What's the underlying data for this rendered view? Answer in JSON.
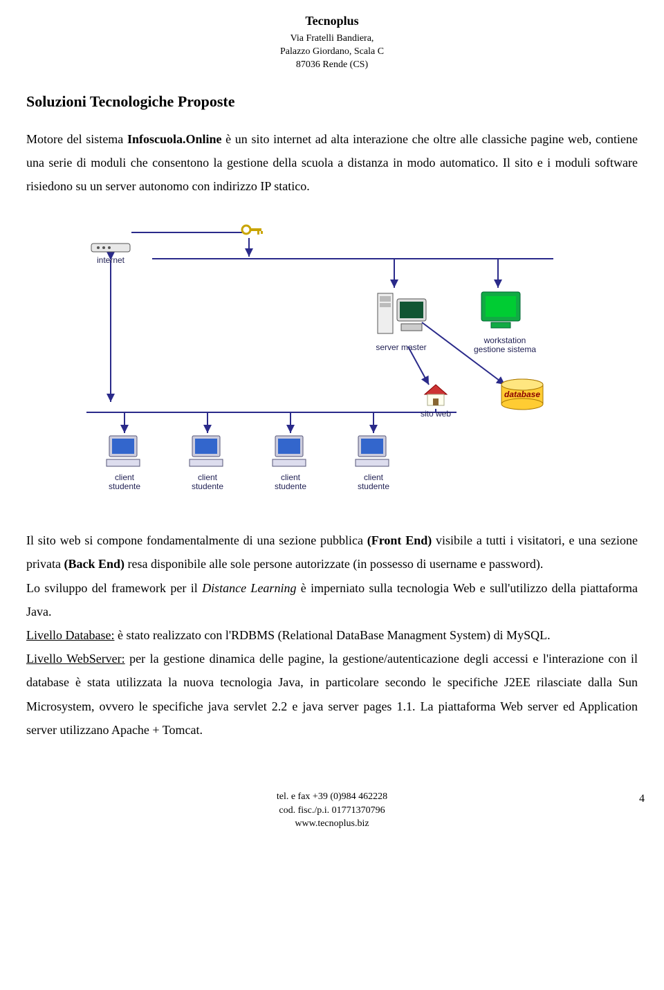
{
  "header": {
    "company": "Tecnoplus",
    "addr1": "Via Fratelli Bandiera,",
    "addr2": "Palazzo Giordano, Scala C",
    "addr3": "87036 Rende (CS)"
  },
  "section_title": "Soluzioni Tecnologiche Proposte",
  "p1": {
    "t1": "Motore del sistema ",
    "b1": "Infoscuola.Online",
    "t2": " è un sito internet ad alta interazione che oltre alle classiche pagine web, contiene una serie di moduli che consentono la gestione della scuola a distanza in modo automatico. Il sito e i moduli software risiedono su un server autonomo con indirizzo IP statico."
  },
  "diagram": {
    "internet": "internet",
    "server": "server master",
    "workstation1": "workstation",
    "workstation2": "gestione sistema",
    "database": "database",
    "sitoweb": "sito web",
    "client1": "client",
    "client2": "studente"
  },
  "p2": {
    "t1": "Il sito web si compone fondamentalmente di una sezione pubblica ",
    "b1": "(Front End)",
    "t2": " visibile a tutti i visitatori, e una sezione privata ",
    "b2": "(Back End)",
    "t3": " resa disponibile alle sole persone autorizzate (in possesso di username e password)."
  },
  "p3": {
    "t1": "Lo sviluppo del framework per il ",
    "i1": "Distance Learning",
    "t2": " è imperniato sulla tecnologia Web e sull'utilizzo della piattaforma Java."
  },
  "p4": {
    "u1": "Livello Database:",
    "t1": "  è stato realizzato con l'RDBMS (Relational DataBase Managment System) di MySQL."
  },
  "p5": {
    "u1": "Livello WebServer:",
    "t1": "   per la gestione dinamica delle pagine, la gestione/autenticazione degli accessi e l'interazione con il database è stata  utilizzata la nuova tecnologia Java,  in particolare secondo le specifiche J2EE rilasciate dalla Sun Microsystem, ovvero le specifiche java servlet 2.2 e java server pages 1.1. La piattaforma Web server  ed Application server utilizzano  Apache + Tomcat."
  },
  "footer": {
    "line1": "tel. e fax +39 (0)984 462228",
    "line2": "cod. fisc./p.i. 01771370796",
    "line3": "www.tecnoplus.biz",
    "page": "4"
  }
}
